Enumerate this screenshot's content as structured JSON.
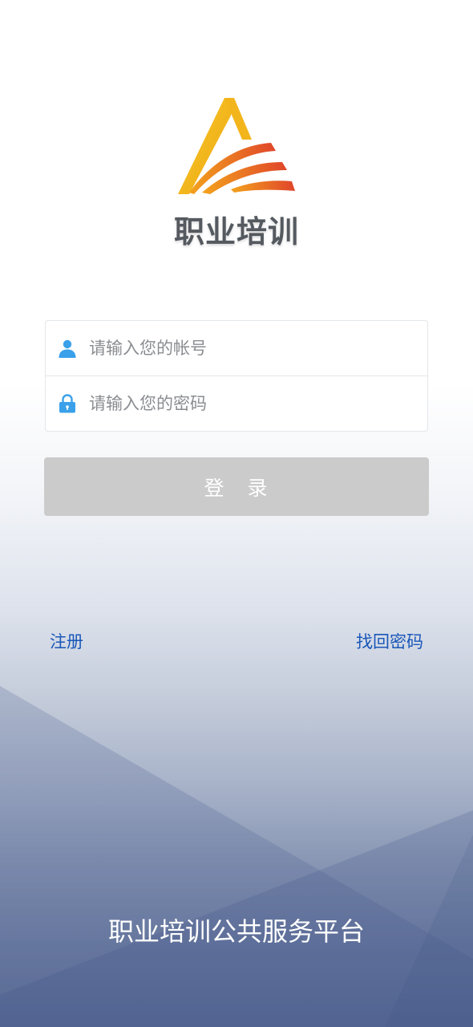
{
  "brand": {
    "logo_icon": "stylized-triangle-A-logo",
    "logo_text": "职业培训",
    "colors": {
      "logo_yellow": "#f2b416",
      "logo_orange": "#e85a24",
      "logo_text": "#555a60"
    }
  },
  "form": {
    "account": {
      "icon": "user-icon",
      "placeholder": "请输入您的帐号",
      "value": ""
    },
    "password": {
      "icon": "lock-icon",
      "placeholder": "请输入您的密码",
      "value": ""
    },
    "icon_color": "#3aa0ea"
  },
  "login_button": {
    "label": "登　录",
    "background": "#cbcbcb",
    "text_color": "#ffffff"
  },
  "links": {
    "register": "注册",
    "forgot_password": "找回密码",
    "color": "#1a57b8"
  },
  "footer": {
    "title": "职业培训公共服务平台"
  }
}
